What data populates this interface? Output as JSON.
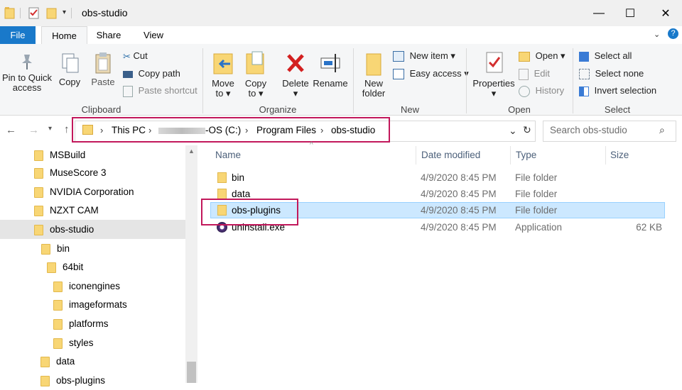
{
  "window": {
    "title": "obs-studio",
    "minimize_glyph": "—",
    "maximize_glyph": "☐",
    "close_glyph": "✕"
  },
  "ribbon_tabs": [
    {
      "label": "File"
    },
    {
      "label": "Home"
    },
    {
      "label": "Share"
    },
    {
      "label": "View"
    }
  ],
  "ribbon": {
    "clipboard": {
      "label": "Clipboard",
      "pin_line1": "Pin to Quick",
      "pin_line2": "access",
      "copy": "Copy",
      "paste": "Paste",
      "cut": "Cut",
      "copy_path": "Copy path",
      "paste_shortcut": "Paste shortcut"
    },
    "organize": {
      "label": "Organize",
      "move_to_1": "Move",
      "move_to_2": "to",
      "copy_to_1": "Copy",
      "copy_to_2": "to",
      "delete": "Delete",
      "rename": "Rename"
    },
    "new": {
      "label": "New",
      "new_folder_1": "New",
      "new_folder_2": "folder",
      "new_item": "New item",
      "easy_access": "Easy access"
    },
    "open": {
      "label": "Open",
      "properties": "Properties",
      "open": "Open",
      "edit": "Edit",
      "history": "History"
    },
    "select": {
      "label": "Select",
      "select_all": "Select all",
      "select_none": "Select none",
      "invert_selection": "Invert selection"
    }
  },
  "address": {
    "crumbs": [
      "This PC",
      "-OS (C:)",
      "Program Files",
      "obs-studio"
    ]
  },
  "search": {
    "placeholder": "Search obs-studio"
  },
  "nav_tree": [
    {
      "label": "MSBuild"
    },
    {
      "label": "MuseScore 3"
    },
    {
      "label": "NVIDIA Corporation"
    },
    {
      "label": "NZXT CAM"
    },
    {
      "label": "obs-studio"
    },
    {
      "label": "bin"
    },
    {
      "label": "64bit"
    },
    {
      "label": "iconengines"
    },
    {
      "label": "imageformats"
    },
    {
      "label": "platforms"
    },
    {
      "label": "styles"
    },
    {
      "label": "data"
    },
    {
      "label": "obs-plugins"
    }
  ],
  "columns": {
    "name": "Name",
    "date": "Date modified",
    "type": "Type",
    "size": "Size"
  },
  "files": [
    {
      "name": "bin",
      "date": "4/9/2020 8:45 PM",
      "type": "File folder",
      "size": ""
    },
    {
      "name": "data",
      "date": "4/9/2020 8:45 PM",
      "type": "File folder",
      "size": ""
    },
    {
      "name": "obs-plugins",
      "date": "4/9/2020 8:45 PM",
      "type": "File folder",
      "size": ""
    },
    {
      "name": "uninstall.exe",
      "date": "4/9/2020 8:45 PM",
      "type": "Application",
      "size": "62 KB"
    }
  ],
  "colors": {
    "accent": "#1979ca",
    "highlight": "#c2185b",
    "selection": "#cce8ff"
  }
}
